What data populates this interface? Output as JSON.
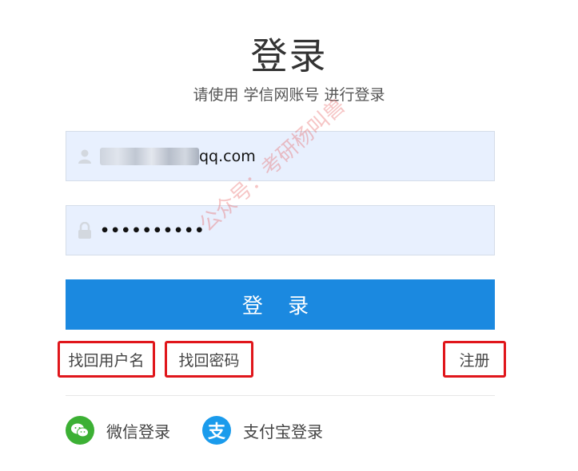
{
  "page": {
    "title": "登录",
    "subtitle": "请使用 学信网账号 进行登录"
  },
  "form": {
    "username": {
      "value_suffix": "qq.com",
      "icon": "user-icon"
    },
    "password": {
      "value": "••••••••••",
      "icon": "lock-icon"
    },
    "login_button": "登 录"
  },
  "links": {
    "forgot_username": "找回用户名",
    "forgot_password": "找回密码",
    "register": "注册"
  },
  "social": {
    "wechat_label": "微信登录",
    "wechat_icon": "wechat-icon",
    "alipay_label": "支付宝登录",
    "alipay_icon": "alipay-icon",
    "alipay_glyph": "支"
  },
  "watermark": {
    "text": "公众号：考研杨叫兽"
  },
  "colors": {
    "primary": "#1b89e0",
    "field_bg": "#e8f0fe",
    "highlight_border": "#e0161b",
    "wechat": "#3cb034",
    "alipay": "#1a9bec"
  }
}
